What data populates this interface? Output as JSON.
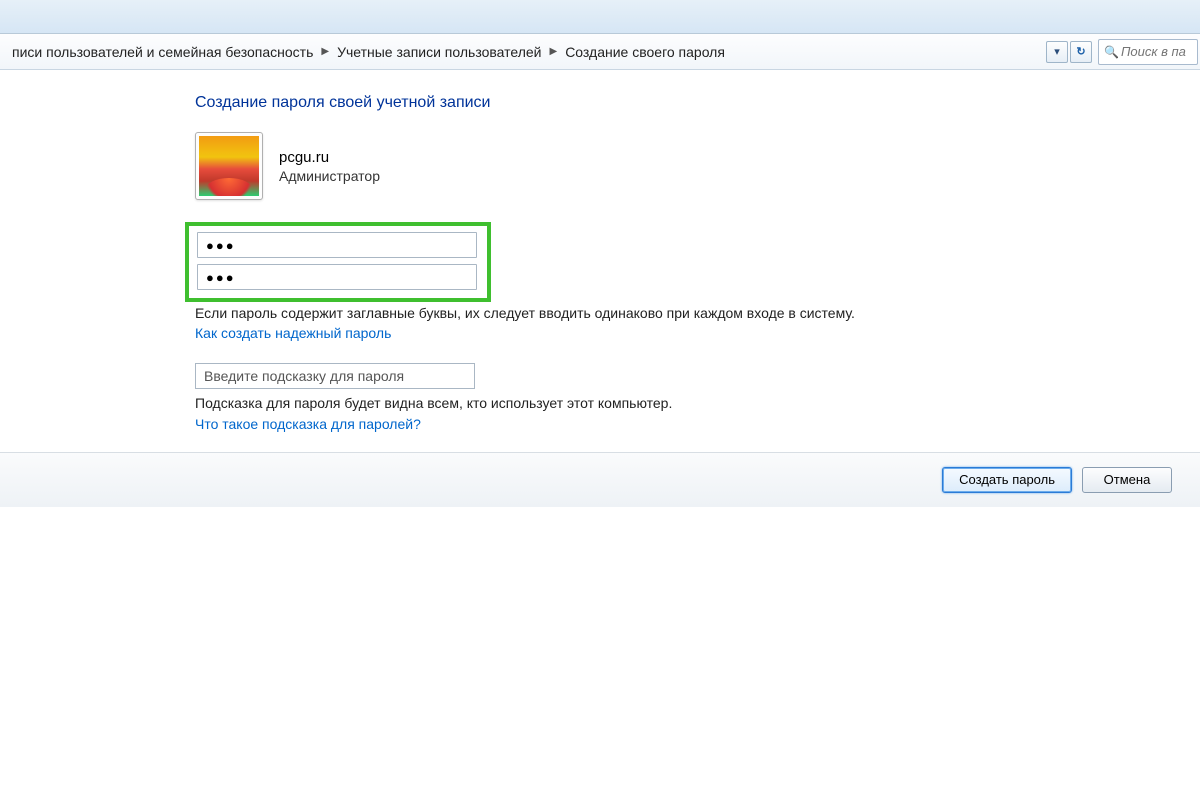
{
  "breadcrumb": {
    "items": [
      "писи пользователей и семейная безопасность",
      "Учетные записи пользователей",
      "Создание своего пароля"
    ]
  },
  "search": {
    "placeholder": "Поиск в па"
  },
  "page": {
    "title": "Создание пароля своей учетной записи"
  },
  "user": {
    "name": "pcgu.ru",
    "role": "Администратор"
  },
  "passwords": {
    "field1": "●●●",
    "field2": "●●●"
  },
  "texts": {
    "caps_note": "Если пароль содержит заглавные буквы, их следует вводить одинаково при каждом входе в систему.",
    "link_strong": "Как создать надежный пароль",
    "hint_placeholder": "Введите подсказку для пароля",
    "hint_note": "Подсказка для пароля будет видна всем, кто использует этот компьютер.",
    "link_hint": "Что такое подсказка для паролей?"
  },
  "buttons": {
    "create": "Создать пароль",
    "cancel": "Отмена"
  }
}
